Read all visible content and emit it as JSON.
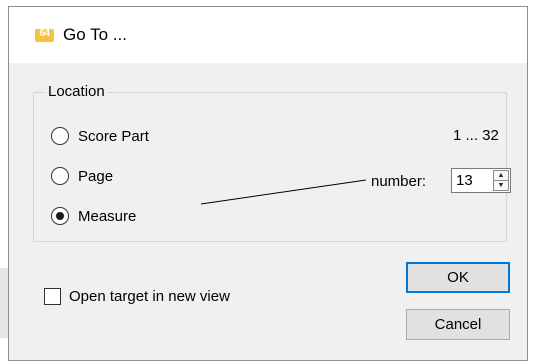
{
  "dialog": {
    "title": "Go To ...",
    "app_icon_label": "64"
  },
  "location": {
    "group_label": "Location",
    "options": [
      {
        "label": "Score Part",
        "checked": false
      },
      {
        "label": "Page",
        "checked": false
      },
      {
        "label": "Measure",
        "checked": true
      }
    ],
    "range": "1 ... 32",
    "number_label": "number:",
    "number_value": "13"
  },
  "open_new_view": {
    "label": "Open target in new view",
    "checked": false
  },
  "buttons": {
    "ok": "OK",
    "cancel": "Cancel"
  },
  "colors": {
    "accent": "#0078d7",
    "icon": "#f3c43c"
  }
}
